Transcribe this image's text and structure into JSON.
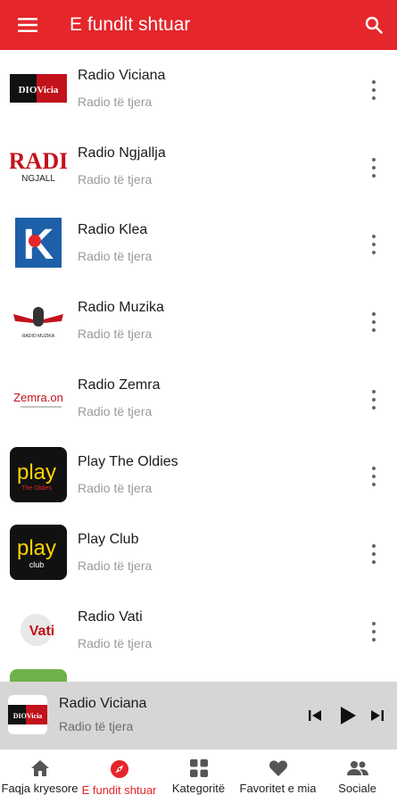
{
  "appbar": {
    "title": "E fundit shtuar",
    "menu_icon": "menu-icon",
    "search_icon": "search-icon",
    "color": "#e5262b"
  },
  "stations": [
    {
      "name": "Radio Viciana",
      "category": "Radio të tjera",
      "logo_text": "DIOVicia"
    },
    {
      "name": "Radio Ngjallja",
      "category": "Radio të tjera",
      "logo_text": "RADI"
    },
    {
      "name": "Radio Klea",
      "category": "Radio të tjera",
      "logo_text": "K"
    },
    {
      "name": "Radio Muzika",
      "category": "Radio të tjera",
      "logo_text": "RADIO MUZIKA"
    },
    {
      "name": "Radio Zemra",
      "category": "Radio të tjera",
      "logo_text": "Zemra.on"
    },
    {
      "name": "Play The Oldies",
      "category": "Radio të tjera",
      "logo_text": "play"
    },
    {
      "name": "Play Club",
      "category": "Radio të tjera",
      "logo_text": "play"
    },
    {
      "name": "Radio Vati",
      "category": "Radio të tjera",
      "logo_text": "Vati"
    }
  ],
  "player": {
    "title": "Radio Viciana",
    "subtitle": "Radio të tjera",
    "logo_text": "DIOVicia",
    "prev_icon": "skip-previous-icon",
    "play_icon": "play-icon",
    "next_icon": "skip-next-icon"
  },
  "bottom_nav": {
    "items": [
      {
        "label": "Faqja kryesore",
        "icon": "home-icon",
        "active": false
      },
      {
        "label": "E fundit shtuar",
        "icon": "compass-icon",
        "active": true
      },
      {
        "label": "Kategoritë",
        "icon": "grid-icon",
        "active": false
      },
      {
        "label": "Favoritet e mia",
        "icon": "heart-icon",
        "active": false
      },
      {
        "label": "Sociale",
        "icon": "people-icon",
        "active": false
      }
    ]
  }
}
